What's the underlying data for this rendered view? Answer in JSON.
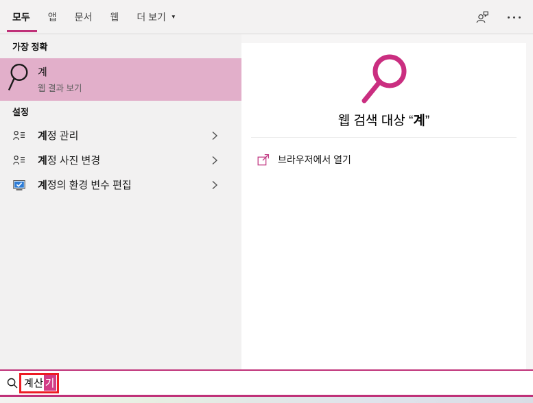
{
  "colors": {
    "accent": "#bf3078",
    "best_match_bg": "#e2afca",
    "selection_bg": "#d23c86",
    "annotation_red": "#ed1c24",
    "icon_magenta": "#ca2e80",
    "monitor_blue": "#2e7cd6"
  },
  "tabs": {
    "items": [
      {
        "label": "모두",
        "selected": true
      },
      {
        "label": "앱",
        "selected": false
      },
      {
        "label": "문서",
        "selected": false
      },
      {
        "label": "웹",
        "selected": false
      },
      {
        "label": "더 보기",
        "selected": false
      }
    ],
    "more_arrow": "▼"
  },
  "icons": {
    "feedback": "person-with-speech-bubble",
    "overflow": "ellipsis-three-dots",
    "best_match": "magnifier",
    "settings_account": "person-with-list-lines",
    "settings_env": "monitor-with-checkmark",
    "chevron": "chevron-right",
    "web_search": "large-magnifier",
    "open_external": "open-in-new-window",
    "search_box": "small-magnifier",
    "more_dropdown": "triangle-down"
  },
  "left_panel": {
    "best_match_header": "가장 정확",
    "best_match": {
      "title": "계",
      "subtitle": "웹 결과 보기"
    },
    "settings_header": "설정",
    "settings_items": [
      {
        "match": "계",
        "rest": "정 관리"
      },
      {
        "match": "계",
        "rest": "정 사진 변경"
      },
      {
        "match": "계",
        "rest": "정의 환경 변수 편집"
      }
    ]
  },
  "right_panel": {
    "heading_prefix": "웹 검색 대상 “",
    "heading_query": "계",
    "heading_suffix": "”",
    "open_in_browser": "브라우저에서 열기"
  },
  "search_bar": {
    "typed_text": "계산",
    "composition_text": "기"
  }
}
